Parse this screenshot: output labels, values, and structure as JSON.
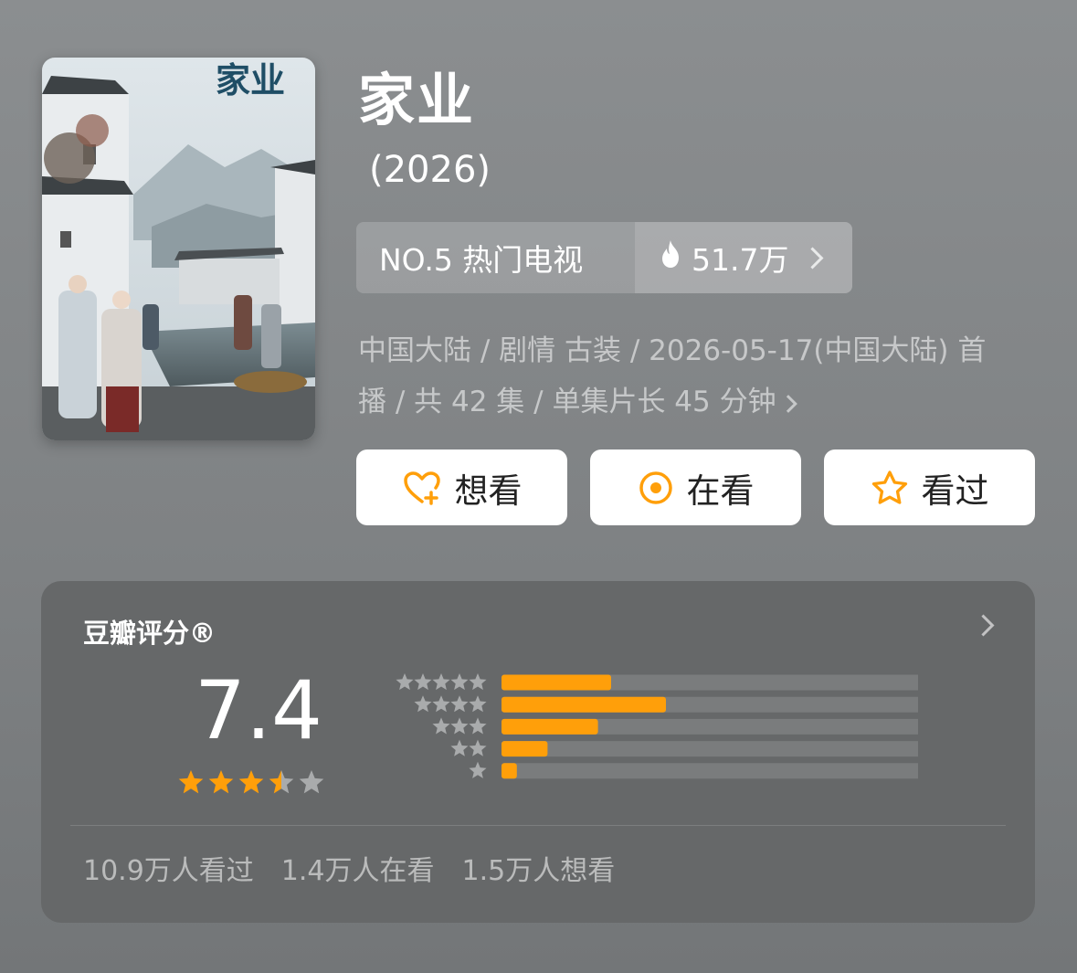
{
  "movie": {
    "title": "家业",
    "year": "(2026)",
    "poster_title": "家业"
  },
  "rank": {
    "label": "NO.5 热门电视",
    "heat": "51.7万"
  },
  "meta": {
    "line1": "中国大陆 / 剧情 古装 / 2026-05-17(中国大陆) 首",
    "line2": "播 / 共 42 集 / 单集片长 45 分钟"
  },
  "actions": {
    "want": "想看",
    "watching": "在看",
    "watched": "看过"
  },
  "rating": {
    "title": "豆瓣评分®",
    "score": "7.4",
    "score_stars": 3.5,
    "distribution": [
      {
        "stars": 5,
        "fraction": 0.25
      },
      {
        "stars": 4,
        "fraction": 0.375
      },
      {
        "stars": 3,
        "fraction": 0.22
      },
      {
        "stars": 2,
        "fraction": 0.105
      },
      {
        "stars": 1,
        "fraction": 0.035
      }
    ],
    "stats": {
      "watched": "10.9万人看过",
      "watching": "1.4万人在看",
      "want": "1.5万人想看"
    }
  },
  "colors": {
    "accent": "#ff9f0a",
    "track": "#7a7c7d",
    "star_empty": "#a9abac"
  },
  "icons": {
    "want": "heart-plus-icon",
    "watching": "target-icon",
    "watched": "star-outline-icon",
    "heat": "flame-icon"
  }
}
